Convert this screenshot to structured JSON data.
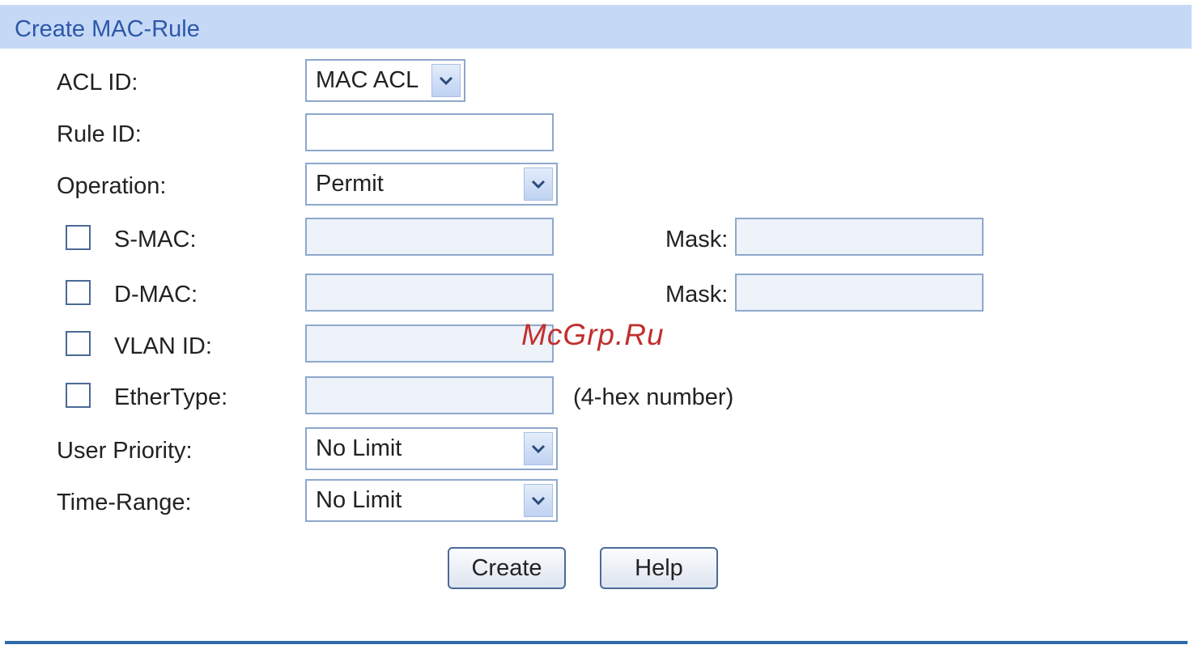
{
  "header": {
    "title": "Create MAC-Rule"
  },
  "form": {
    "acl_id": {
      "label": "ACL ID:",
      "value": "MAC ACL"
    },
    "rule_id": {
      "label": "Rule ID:",
      "value": ""
    },
    "operation": {
      "label": "Operation:",
      "value": "Permit"
    },
    "s_mac": {
      "label": "S-MAC:",
      "value": "",
      "mask_label": "Mask:",
      "mask_value": "",
      "checked": false
    },
    "d_mac": {
      "label": "D-MAC:",
      "value": "",
      "mask_label": "Mask:",
      "mask_value": "",
      "checked": false
    },
    "vlan_id": {
      "label": "VLAN ID:",
      "value": "",
      "checked": false
    },
    "ethertype": {
      "label": "EtherType:",
      "value": "",
      "hint": "(4-hex number)",
      "checked": false
    },
    "user_priority": {
      "label": "User Priority:",
      "value": "No Limit"
    },
    "time_range": {
      "label": "Time-Range:",
      "value": "No Limit"
    }
  },
  "buttons": {
    "create": "Create",
    "help": "Help"
  },
  "watermark": "McGrp.Ru",
  "colors": {
    "header_bg": "#c5d9f7",
    "header_text": "#2d57a8",
    "field_border": "#8ea8cc",
    "footer_line": "#2f6aa8",
    "watermark": "#c0302e"
  },
  "icons": {
    "dropdown": "chevron-down-icon"
  }
}
